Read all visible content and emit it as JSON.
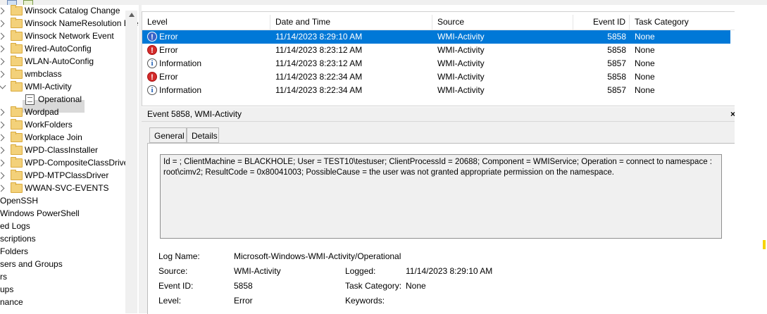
{
  "tree": {
    "items": [
      {
        "label": "Winsock Catalog Change",
        "type": "folder",
        "expander": "right"
      },
      {
        "label": "Winsock NameResolution Event",
        "type": "folder",
        "expander": "right"
      },
      {
        "label": "Winsock Network Event",
        "type": "folder",
        "expander": "right"
      },
      {
        "label": "Wired-AutoConfig",
        "type": "folder",
        "expander": "right"
      },
      {
        "label": "WLAN-AutoConfig",
        "type": "folder",
        "expander": "right"
      },
      {
        "label": "wmbclass",
        "type": "folder",
        "expander": "right"
      },
      {
        "label": "WMI-Activity",
        "type": "folder",
        "expander": "down"
      },
      {
        "label": "Operational",
        "type": "log",
        "selected": true
      },
      {
        "label": "Wordpad",
        "type": "folder",
        "expander": "right"
      },
      {
        "label": "WorkFolders",
        "type": "folder",
        "expander": "right"
      },
      {
        "label": "Workplace Join",
        "type": "folder",
        "expander": "right"
      },
      {
        "label": "WPD-ClassInstaller",
        "type": "folder",
        "expander": "right"
      },
      {
        "label": "WPD-CompositeClassDriver",
        "type": "folder",
        "expander": "right"
      },
      {
        "label": "WPD-MTPClassDriver",
        "type": "folder",
        "expander": "right"
      },
      {
        "label": "WWAN-SVC-EVENTS",
        "type": "folder",
        "expander": "right"
      },
      {
        "label": "OpenSSH",
        "type": "text"
      },
      {
        "label": "Windows PowerShell",
        "type": "text"
      },
      {
        "label": "ed Logs",
        "type": "text"
      },
      {
        "label": "scriptions",
        "type": "text"
      },
      {
        "label": "Folders",
        "type": "text"
      },
      {
        "label": "sers and Groups",
        "type": "text"
      },
      {
        "label": "rs",
        "type": "text"
      },
      {
        "label": "ups",
        "type": "text"
      },
      {
        "label": "nance",
        "type": "text"
      }
    ]
  },
  "event_list": {
    "columns": [
      "Level",
      "Date and Time",
      "Source",
      "Event ID",
      "Task Category"
    ],
    "rows": [
      {
        "level": "Error",
        "icon": "error-icon",
        "datetime": "11/14/2023 8:29:10 AM",
        "source": "WMI-Activity",
        "event_id": "5858",
        "task": "None",
        "selected": true
      },
      {
        "level": "Error",
        "icon": "error-icon",
        "datetime": "11/14/2023 8:23:12 AM",
        "source": "WMI-Activity",
        "event_id": "5858",
        "task": "None"
      },
      {
        "level": "Information",
        "icon": "info-icon",
        "datetime": "11/14/2023 8:23:12 AM",
        "source": "WMI-Activity",
        "event_id": "5857",
        "task": "None"
      },
      {
        "level": "Error",
        "icon": "error-icon",
        "datetime": "11/14/2023 8:22:34 AM",
        "source": "WMI-Activity",
        "event_id": "5858",
        "task": "None"
      },
      {
        "level": "Information",
        "icon": "info-icon",
        "datetime": "11/14/2023 8:22:34 AM",
        "source": "WMI-Activity",
        "event_id": "5857",
        "task": "None"
      }
    ]
  },
  "detail": {
    "title": "Event 5858, WMI-Activity",
    "close_glyph": "×",
    "tabs": [
      {
        "label": "General",
        "active": true
      },
      {
        "label": "Details",
        "active": false
      }
    ],
    "description": "Id = ; ClientMachine = BLACKHOLE; User = TEST10\\testuser; ClientProcessId = 20688; Component = WMIService; Operation = connect to namespace : root\\cimv2; ResultCode = 0x80041003; PossibleCause = the user was not granted appropriate permission on the namespace.",
    "properties": {
      "log_name_label": "Log Name:",
      "log_name": "Microsoft-Windows-WMI-Activity/Operational",
      "source_label": "Source:",
      "source": "WMI-Activity",
      "logged_label": "Logged:",
      "logged": "11/14/2023 8:29:10 AM",
      "event_id_label": "Event ID:",
      "event_id": "5858",
      "task_category_label": "Task Category:",
      "task_category": "None",
      "level_label": "Level:",
      "level": "Error",
      "keywords_label": "Keywords:",
      "keywords": ""
    }
  },
  "colors": {
    "selection": "#0078d7",
    "error": "#d32b2b",
    "folder": "#f3d17a"
  }
}
